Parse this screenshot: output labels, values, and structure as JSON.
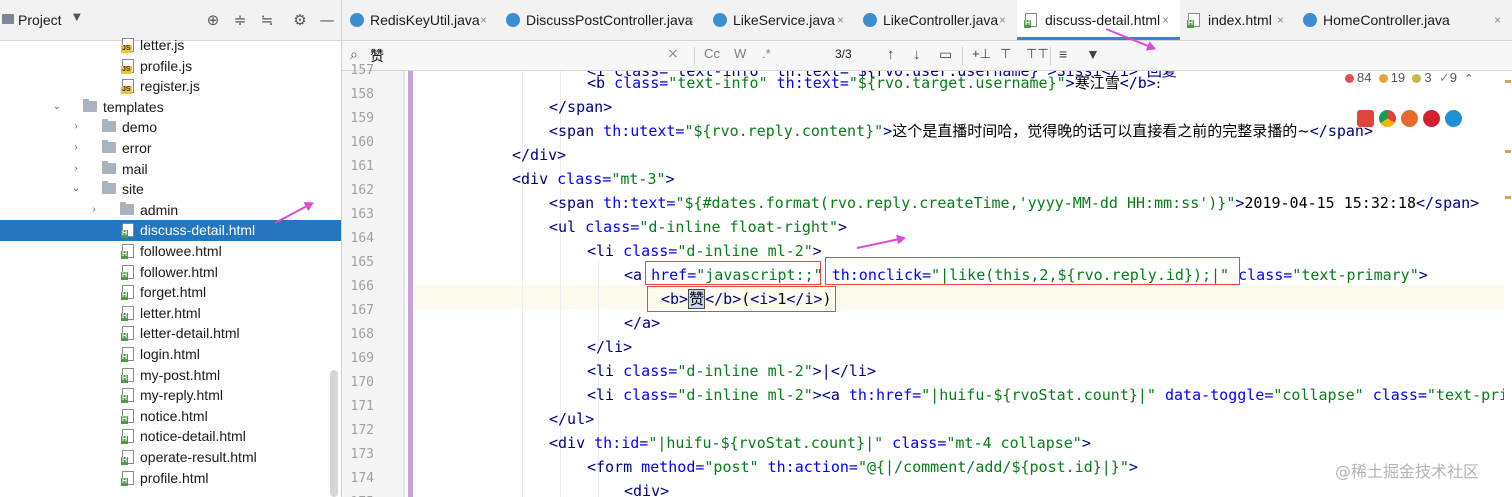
{
  "project_panel": {
    "title": "Project",
    "dropdown_icon": "▼",
    "header_icons": [
      "target-icon",
      "expand-all-icon",
      "collapse-all-icon",
      "gear-icon",
      "minimize-icon"
    ],
    "tree": [
      {
        "label": "letter.js",
        "type": "js",
        "arrow": ""
      },
      {
        "label": "profile.js",
        "type": "js",
        "arrow": ""
      },
      {
        "label": "register.js",
        "type": "js",
        "arrow": ""
      },
      {
        "label": "templates",
        "type": "folder",
        "arrow": "⌄"
      },
      {
        "label": "demo",
        "type": "folder",
        "arrow": "›"
      },
      {
        "label": "error",
        "type": "folder",
        "arrow": "›"
      },
      {
        "label": "mail",
        "type": "folder",
        "arrow": "›"
      },
      {
        "label": "site",
        "type": "folder",
        "arrow": "⌄"
      },
      {
        "label": "admin",
        "type": "folder",
        "arrow": "›"
      },
      {
        "label": "discuss-detail.html",
        "type": "html",
        "arrow": "",
        "selected": true
      },
      {
        "label": "followee.html",
        "type": "html",
        "arrow": ""
      },
      {
        "label": "follower.html",
        "type": "html",
        "arrow": ""
      },
      {
        "label": "forget.html",
        "type": "html",
        "arrow": ""
      },
      {
        "label": "letter.html",
        "type": "html",
        "arrow": ""
      },
      {
        "label": "letter-detail.html",
        "type": "html",
        "arrow": ""
      },
      {
        "label": "login.html",
        "type": "html",
        "arrow": ""
      },
      {
        "label": "my-post.html",
        "type": "html",
        "arrow": ""
      },
      {
        "label": "my-reply.html",
        "type": "html",
        "arrow": ""
      },
      {
        "label": "notice.html",
        "type": "html",
        "arrow": ""
      },
      {
        "label": "notice-detail.html",
        "type": "html",
        "arrow": ""
      },
      {
        "label": "operate-result.html",
        "type": "html",
        "arrow": ""
      },
      {
        "label": "profile.html",
        "type": "html",
        "arrow": ""
      }
    ]
  },
  "tabs": [
    {
      "label": "RedisKeyUtil.java",
      "type": "java"
    },
    {
      "label": "DiscussPostController.java",
      "type": "java"
    },
    {
      "label": "LikeService.java",
      "type": "java"
    },
    {
      "label": "LikeController.java",
      "type": "java"
    },
    {
      "label": "discuss-detail.html",
      "type": "html",
      "active": true
    },
    {
      "label": "index.html",
      "type": "html"
    },
    {
      "label": "HomeController.java",
      "type": "java"
    }
  ],
  "tab_close": "×",
  "search": {
    "value": "赞",
    "clear": "×",
    "case_btn": "Cc",
    "word_btn": "W",
    "regex_btn": ".*",
    "match_count": "3/3",
    "icons": [
      "arrow-up-icon",
      "arrow-down-icon",
      "select-all-icon",
      "add-selection-icon",
      "remove-selection-icon",
      "select-all-occurrences-icon",
      "multiline-icon",
      "filter-icon"
    ]
  },
  "editor": {
    "line_numbers": [
      "157",
      "158",
      "159",
      "160",
      "161",
      "162",
      "163",
      "164",
      "165",
      "166",
      "167",
      "168",
      "169",
      "170",
      "171",
      "172",
      "173",
      "174",
      "175"
    ],
    "lines": {
      "l157a": "<i class=\"text-info\" th:text=\"${rvo.user.username}\">Sissi</i> 回复",
      "l158a": "<b",
      "l158b": " class=",
      "l158c": "\"text-info\"",
      "l158d": " th:text=",
      "l158e": "\"${rvo.target.username}\"",
      "l158f": ">",
      "l158g": "寒江雪",
      "l158h": "</b>",
      "l158i": ":",
      "l159a": "</span>",
      "l160a": "<span",
      "l160b": " th:utext=",
      "l160c": "\"${rvo.reply.content}\"",
      "l160d": ">",
      "l160e": "这个是直播时间哈，觉得晚的话可以直接看之前的完整录播的~",
      "l160f": "</span>",
      "l161a": "</div>",
      "l162a": "<div",
      "l162b": " class=",
      "l162c": "\"mt-3\"",
      "l162d": ">",
      "l163a": "<span",
      "l163b": " th:text=",
      "l163c": "\"${#dates.format(rvo.reply.createTime,'yyyy-MM-dd HH:mm:ss')}\"",
      "l163d": ">",
      "l163e": "2019-04-15 15:32:18",
      "l163f": "</span>",
      "l164a": "<ul",
      "l164b": " class=",
      "l164c": "\"d-inline float-right\"",
      "l164d": ">",
      "l165a": "<li",
      "l165b": " class=",
      "l165c": "\"d-inline ml-2\"",
      "l165d": ">",
      "l166a": "<a",
      "l166b": " href=",
      "l166c": "\"javascript:;\"",
      "l166d": " th:onclick=",
      "l166e": "\"|like(this,2,${rvo.reply.id});|\"",
      "l166f": " class=",
      "l166g": "\"text-primary\"",
      "l166h": ">",
      "l167a": "<b>",
      "l167b": "赞",
      "l167c": "</b>",
      "l167d": "(",
      "l167e": "<i>",
      "l167f": "1",
      "l167g": "</i>",
      "l167h": ")",
      "l168a": "</a>",
      "l169a": "</li>",
      "l170a": "<li",
      "l170b": " class=",
      "l170c": "\"d-inline ml-2\"",
      "l170d": ">|",
      "l170e": "</li>",
      "l171a": "<li",
      "l171b": " class=",
      "l171c": "\"d-inline ml-2\"",
      "l171d": "><a",
      "l171e": " th:href=",
      "l171f": "\"|huifu-${rvoStat.count}|\"",
      "l171g": " data-toggle=",
      "l171h": "\"collapse\"",
      "l171i": " class=",
      "l171j": "\"text-primary\"",
      "l172a": "</ul>",
      "l173a": "<div",
      "l173b": " th:id=",
      "l173c": "\"|huifu-${rvoStat.count}|\"",
      "l173d": " class=",
      "l173e": "\"mt-4 collapse\"",
      "l173f": ">",
      "l174a": "<form",
      "l174b": " method=",
      "l174c": "\"post\"",
      "l174d": " th:action=",
      "l174e": "\"@{|/comment/add/${post.id}|}\"",
      "l174f": ">",
      "l175a": "<div>"
    }
  },
  "inspections": {
    "errors": "84",
    "warnings": "19",
    "weak_warnings": "3",
    "typos": "9",
    "error_color": "#e05252",
    "warning_color": "#e8a33d",
    "weak_color": "#c9b84a",
    "typo_color": "#5da05d"
  },
  "browsers": [
    "jetbrains-icon",
    "chrome-icon",
    "firefox-icon",
    "opera-icon",
    "edge-icon"
  ],
  "watermark": "@稀土掘金技术社区",
  "colors": {
    "selection": "#2675bf",
    "tag": "#000080",
    "attr": "#0000ff",
    "string": "#067d17",
    "annotation_box": "#e64646",
    "arrow": "#d94cd6"
  }
}
